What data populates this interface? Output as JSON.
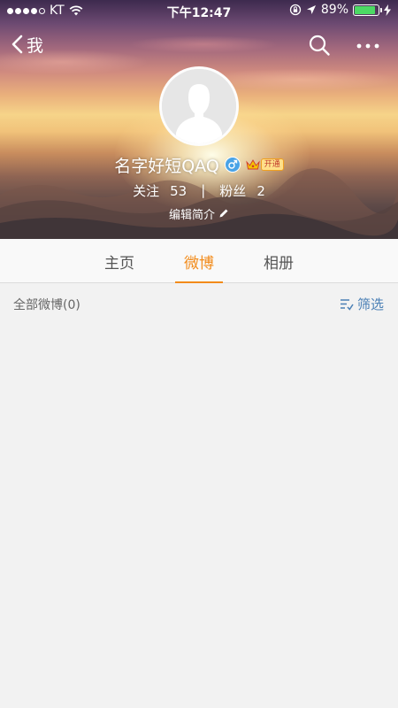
{
  "status_bar": {
    "carrier": "KT",
    "time": "下午12:47",
    "battery_percent": "89%",
    "battery_level": 0.89
  },
  "nav": {
    "back_label": "我"
  },
  "profile": {
    "name": "名字好短QAQ",
    "vip_label": "开通",
    "following_label": "关注",
    "following_count": "53",
    "separator": "|",
    "followers_label": "粉丝",
    "followers_count": "2",
    "edit_bio_label": "编辑简介"
  },
  "tabs": [
    {
      "label": "主页",
      "active": false
    },
    {
      "label": "微博",
      "active": true
    },
    {
      "label": "相册",
      "active": false
    }
  ],
  "filter_bar": {
    "count_label": "全部微博(0)",
    "filter_label": "筛选"
  },
  "colors": {
    "accent": "#f28b1a",
    "link": "#4a7fb5",
    "gender_badge": "#4aa3e6",
    "battery": "#4cd964"
  }
}
